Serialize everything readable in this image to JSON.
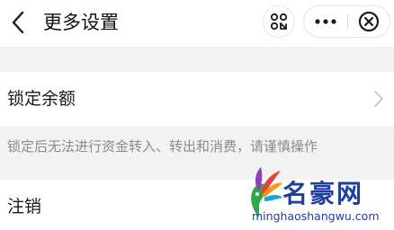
{
  "navbar": {
    "title": "更多设置",
    "back_icon": "chevron-left-icon",
    "scan_icon": "scan-icon",
    "more_icon": "ellipsis-icon",
    "close_icon": "close-circle-icon"
  },
  "settings": {
    "lock_balance": {
      "label": "锁定余额",
      "icon": "chevron-right-icon"
    },
    "lock_hint": "锁定后无法进行资金转入、转出和消费，请谨慎操作",
    "cancel_account": {
      "label": "注销"
    }
  },
  "watermark": {
    "title": "名豪网",
    "url": "minghaoshangwu.com"
  },
  "colors": {
    "background": "#f2f2f2",
    "surface": "#ffffff",
    "hint_text": "#8a8a8a",
    "watermark": "#1d3f9e"
  }
}
